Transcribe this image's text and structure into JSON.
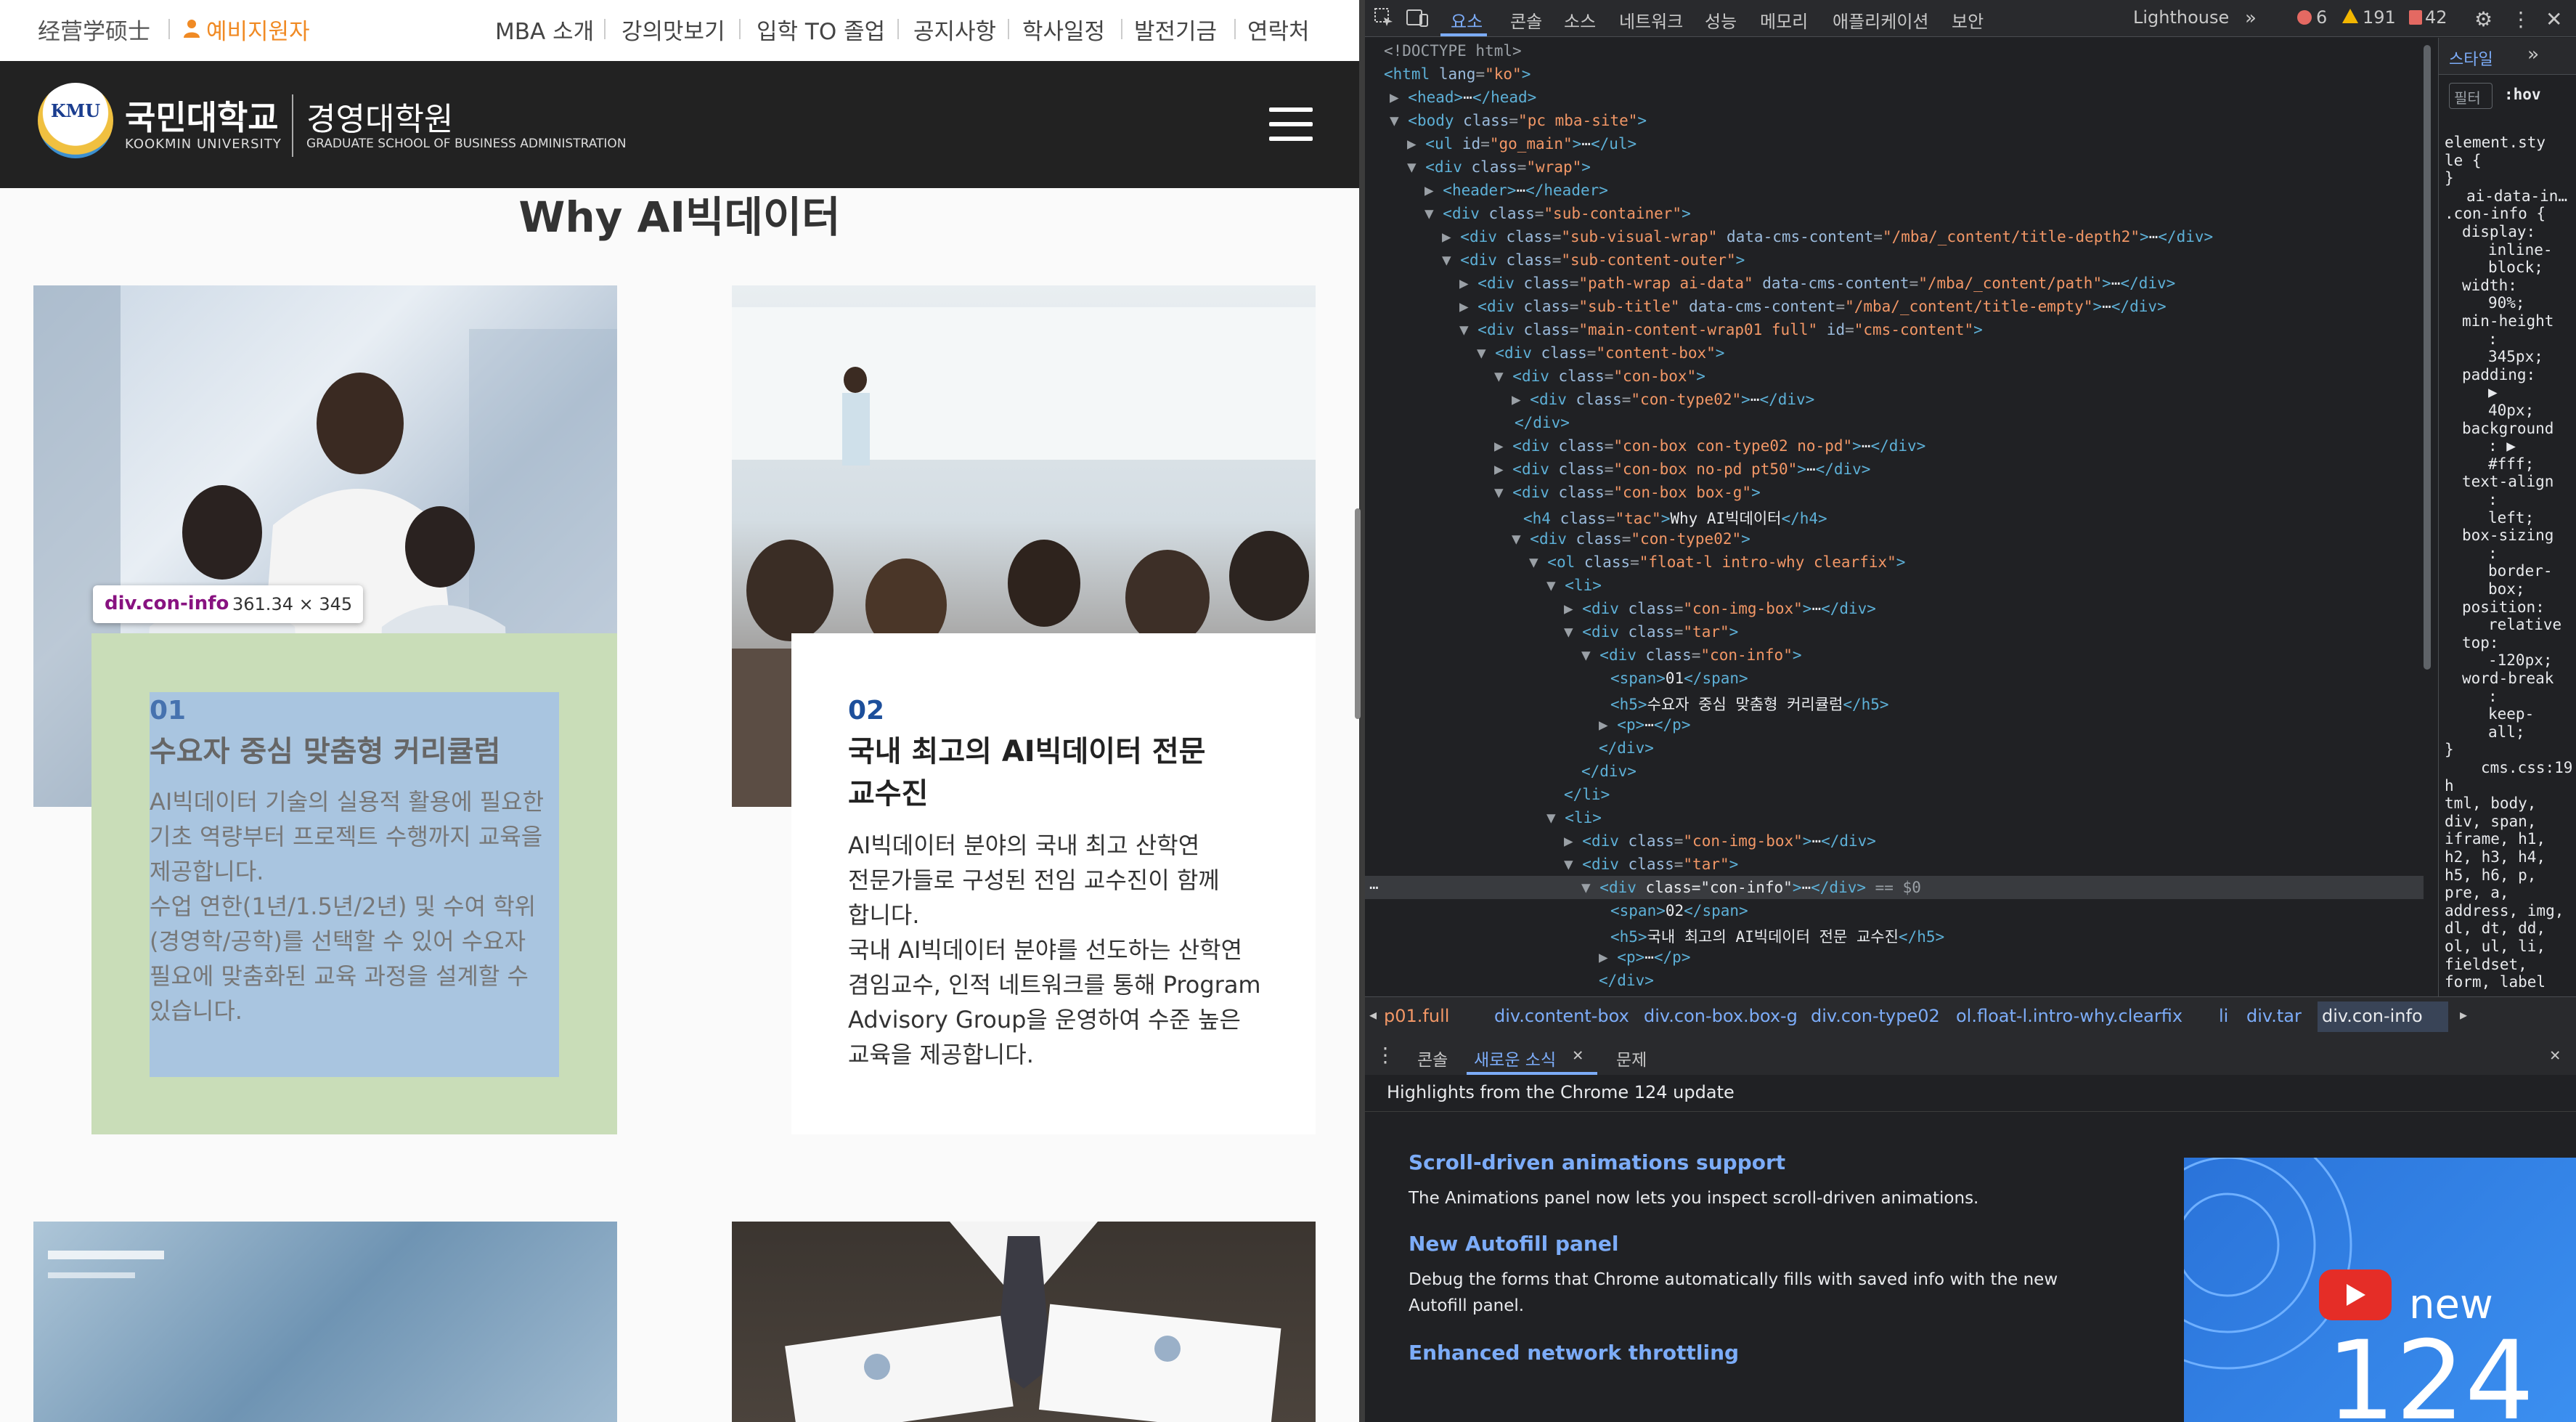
{
  "site": {
    "topbar": {
      "left_text": "经营学硕士",
      "highlight_text": "예비지원자",
      "menu": [
        "MBA 소개",
        "강의맛보기",
        "입학 TO 졸업",
        "공지사항",
        "학사일정",
        "발전기금",
        "연락처"
      ]
    },
    "header": {
      "logo_mark": "KMU",
      "univ_kr": "국민대학교",
      "univ_en": "KOOKMIN UNIVERSITY",
      "school_kr": "경영대학원",
      "school_en": "GRADUATE SCHOOL OF BUSINESS ADMINISTRATION"
    },
    "section_title": "Why AI빅데이터",
    "inspect_tooltip": {
      "selector": "div.con-info",
      "size": "361.34 × 345"
    },
    "cards": [
      {
        "num": "01",
        "title": "수요자 중심 맞춤형 커리큘럼",
        "lines": [
          "AI빅데이터 기술의 실용적 활용에 필요한",
          "기초 역량부터 프로젝트 수행까지 교육을",
          "제공합니다.",
          "수업 연한(1년/1.5년/2년) 및 수여 학위",
          "(경영학/공학)를 선택할 수 있어 수요자",
          "필요에 맞춤화된 교육 과정을 설계할 수",
          "있습니다."
        ]
      },
      {
        "num": "02",
        "title_lines": [
          "국내 최고의 AI빅데이터 전문",
          "교수진"
        ],
        "lines": [
          "AI빅데이터 분야의 국내 최고 산학연",
          "전문가들로 구성된 전임 교수진이 함께",
          "합니다.",
          "국내 AI빅데이터 분야를 선도하는 산학연",
          "겸임교수, 인적 네트워크를 통해 Program",
          "Advisory Group을 운영하여 수준 높은",
          "교육을 제공합니다."
        ]
      }
    ]
  },
  "devtools": {
    "tabs": [
      "요소",
      "콘솔",
      "소스",
      "네트워크",
      "성능",
      "메모리",
      "애플리케이션",
      "보안",
      "Lighthouse"
    ],
    "counts": {
      "errors": "6",
      "warnings": "191",
      "issues": "42"
    },
    "side_tabs": [
      "스타일"
    ],
    "filter_placeholder": "필터",
    "hov": ":hov",
    "styles_lines": [
      "element.sty",
      "le {",
      "}",
      "ai-data-in…",
      ".con-info {",
      "display:",
      "inline-",
      "block;",
      "width:",
      "90%;",
      "min-height",
      ":",
      "345px;",
      "padding:",
      "▶",
      "40px;",
      "background",
      ": ▶",
      "#fff;",
      "text-align",
      ":",
      "left;",
      "box-sizing",
      ":",
      "border-",
      "box;",
      "position:",
      "relative",
      "top:",
      "-120px;",
      "word-break",
      ":",
      "keep-",
      "all;",
      "}",
      "cms.css:19",
      "h",
      "tml, body,",
      "div, span,",
      "iframe, h1,",
      "h2, h3, h4,",
      "h5, h6, p,",
      "pre, a,",
      "address, img,",
      "dl, dt, dd,",
      "ol, ul, li,",
      "fieldset,",
      "form, label"
    ],
    "breadcrumbs": [
      "p01.full",
      "div.content-box",
      "div.con-box.box-g",
      "div.con-type02",
      "ol.float-l.intro-why.clearfix",
      "li",
      "div.tar",
      "div.con-info"
    ],
    "drawer_tabs": [
      "콘솔",
      "새로운 소식",
      "문제"
    ],
    "whats_new": {
      "headline": "Highlights from the Chrome 124 update",
      "items": [
        {
          "title": "Scroll-driven animations support",
          "desc": "The Animations panel now lets you inspect scroll-driven animations."
        },
        {
          "title": "New Autofill panel",
          "desc": "Debug the forms that Chrome automatically fills with saved info with the new Autofill panel."
        },
        {
          "title": "Enhanced network throttling",
          "desc": ""
        }
      ],
      "video_label": "new",
      "video_version": "124"
    }
  }
}
